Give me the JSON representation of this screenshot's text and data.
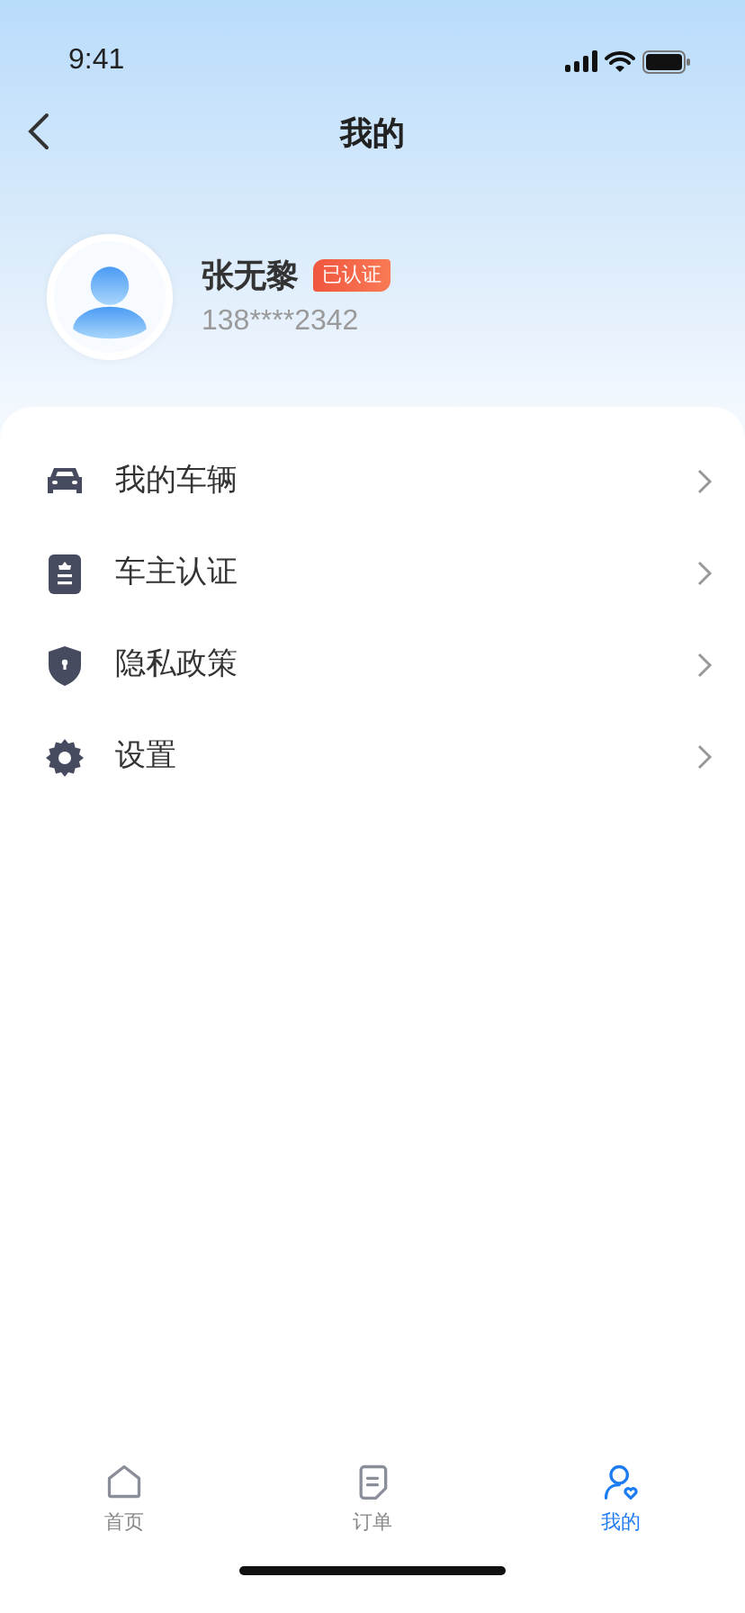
{
  "status_bar": {
    "time": "9:41"
  },
  "header": {
    "title": "我的"
  },
  "profile": {
    "name": "张无黎",
    "badge": "已认证",
    "phone": "138****2342"
  },
  "menu": [
    {
      "kind": "car",
      "label": "我的车辆"
    },
    {
      "kind": "badge",
      "label": "车主认证"
    },
    {
      "kind": "shield",
      "label": "隐私政策"
    },
    {
      "kind": "gear",
      "label": "设置"
    }
  ],
  "tab_bar": [
    {
      "kind": "home",
      "label": "首页",
      "selected": false
    },
    {
      "kind": "doc",
      "label": "订单",
      "selected": false
    },
    {
      "kind": "user",
      "label": "我的",
      "selected": true
    }
  ]
}
